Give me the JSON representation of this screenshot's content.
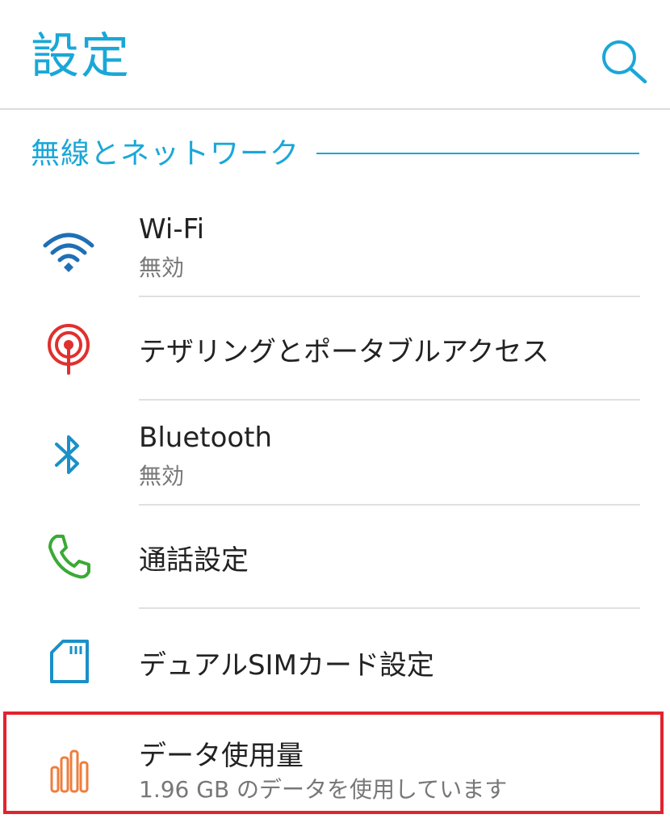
{
  "header": {
    "title": "設定",
    "search_icon": "search-icon"
  },
  "section": {
    "title": "無線とネットワーク"
  },
  "items": [
    {
      "icon": "wifi-icon",
      "color": "#1f6fb5",
      "title": "Wi-Fi",
      "subtitle": "無効"
    },
    {
      "icon": "hotspot-icon",
      "color": "#e0302e",
      "title": "テザリングとポータブルアクセス"
    },
    {
      "icon": "bluetooth-icon",
      "color": "#1a90c8",
      "title": "Bluetooth",
      "subtitle": "無効"
    },
    {
      "icon": "phone-icon",
      "color": "#3aaa35",
      "title": "通話設定"
    },
    {
      "icon": "sim-card-icon",
      "color": "#1a90c8",
      "title": "デュアルSIMカード設定"
    },
    {
      "icon": "data-usage-icon",
      "color": "#ef7d3c",
      "title": "データ使用量",
      "subtitle": "1.96 GB のデータを使用しています"
    }
  ],
  "colors": {
    "accent": "#1aa7d8",
    "highlight": "#e2232f"
  }
}
